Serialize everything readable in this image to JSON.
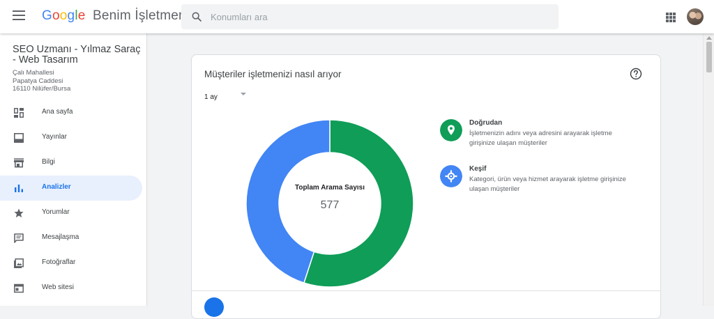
{
  "header": {
    "logo": {
      "g1": "G",
      "g2": "o",
      "g3": "o",
      "g1b": "g",
      "g4": "l",
      "g2b": "e"
    },
    "product": "Benim İşletmem",
    "search": {
      "placeholder": "Konumları ara",
      "value": ""
    },
    "icons": [
      "menu-icon",
      "search-icon",
      "apps-icon",
      "avatar"
    ]
  },
  "business": {
    "name": "SEO Uzmanı - Yılmaz Saraç - Web Tasarım",
    "address": [
      "Çalı Mahallesi",
      "Papatya Caddesi",
      "16110 Nilüfer/Bursa"
    ]
  },
  "sidebar": {
    "items": [
      {
        "label": "Ana sayfa",
        "icon": "dashboard-icon"
      },
      {
        "label": "Yayınlar",
        "icon": "posts-icon"
      },
      {
        "label": "Bilgi",
        "icon": "storefront-icon"
      },
      {
        "label": "Analizler",
        "icon": "insights-icon",
        "active": true
      },
      {
        "label": "Yorumlar",
        "icon": "star-icon"
      },
      {
        "label": "Mesajlaşma",
        "icon": "message-icon"
      },
      {
        "label": "Fotoğraflar",
        "icon": "photo-icon"
      },
      {
        "label": "Web sitesi",
        "icon": "website-icon"
      }
    ]
  },
  "card": {
    "title": "Müşteriler işletmenizi nasıl arıyor",
    "period": "1 ay",
    "donut_title": "Toplam Arama Sayısı",
    "donut_total": "577",
    "legend": [
      {
        "name": "Doğrudan",
        "desc": "İşletmenizin adını veya adresini arayarak işletme girişinize ulaşan müşteriler",
        "icon": "location-pin-icon",
        "color": "#0f9d58"
      },
      {
        "name": "Keşif",
        "desc": "Kategori, ürün veya hizmet arayarak işletme girişinize ulaşan müşteriler",
        "icon": "explore-icon",
        "color": "#4285f4"
      }
    ]
  },
  "chart_data": {
    "type": "pie",
    "categories": [
      "Doğrudan",
      "Keşif"
    ],
    "values": [
      0.55,
      0.45
    ],
    "colors": [
      "#0f9d58",
      "#4285f4"
    ],
    "title": "Toplam Arama Sayısı",
    "total": "577"
  },
  "colors": {
    "accent": "#1a73e8",
    "active_bg": "#e8f0fe",
    "green": "#0f9d58",
    "blue": "#4285f4"
  }
}
